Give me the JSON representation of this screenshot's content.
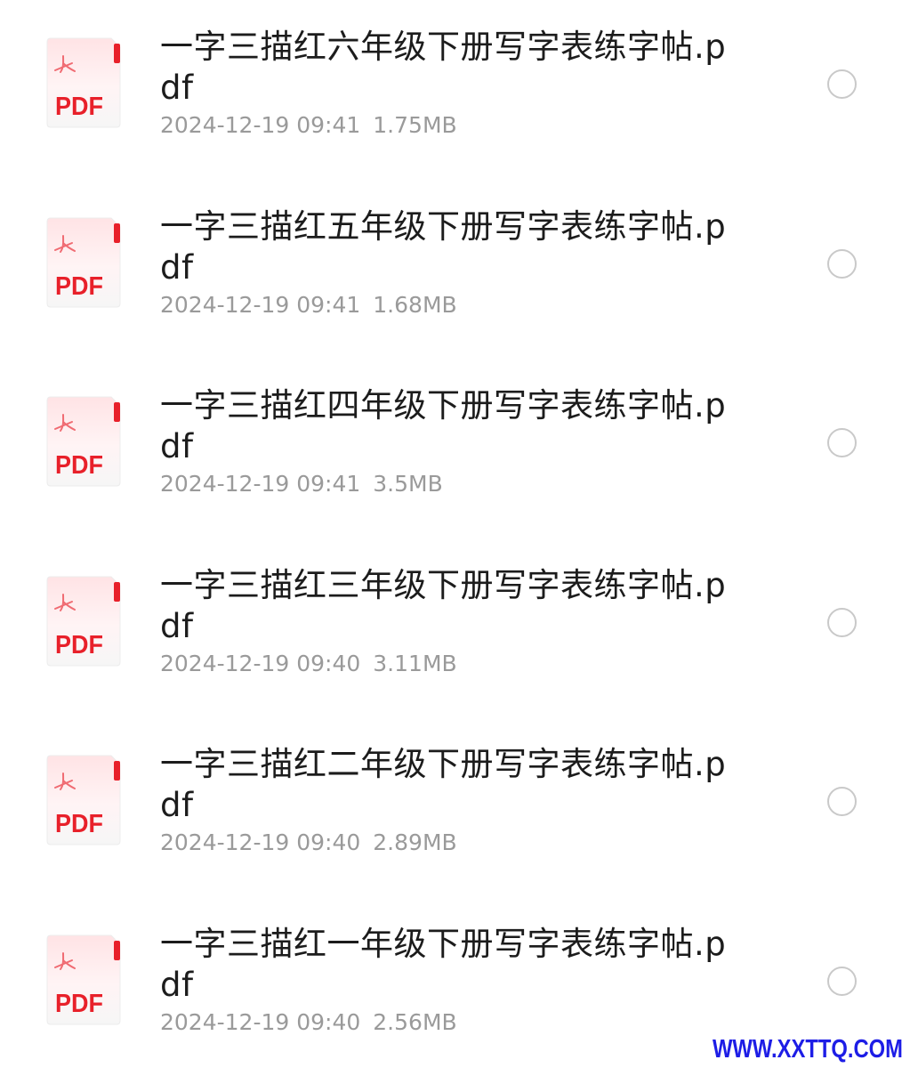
{
  "files": [
    {
      "name": "一字三描红六年级下册写字表练字帖.pdf",
      "date": "2024-12-19 09:41",
      "size": "1.75MB",
      "icon": "pdf-file-icon",
      "badge": "PDF"
    },
    {
      "name": "一字三描红五年级下册写字表练字帖.pdf",
      "date": "2024-12-19 09:41",
      "size": "1.68MB",
      "icon": "pdf-file-icon",
      "badge": "PDF"
    },
    {
      "name": "一字三描红四年级下册写字表练字帖.pdf",
      "date": "2024-12-19 09:41",
      "size": "3.5MB",
      "icon": "pdf-file-icon",
      "badge": "PDF"
    },
    {
      "name": "一字三描红三年级下册写字表练字帖.pdf",
      "date": "2024-12-19 09:40",
      "size": "3.11MB",
      "icon": "pdf-file-icon",
      "badge": "PDF"
    },
    {
      "name": "一字三描红二年级下册写字表练字帖.pdf",
      "date": "2024-12-19 09:40",
      "size": "2.89MB",
      "icon": "pdf-file-icon",
      "badge": "PDF"
    },
    {
      "name": "一字三描红一年级下册写字表练字帖.pdf",
      "date": "2024-12-19 09:40",
      "size": "2.56MB",
      "icon": "pdf-file-icon",
      "badge": "PDF"
    }
  ],
  "watermark": "WWW.XXTTQ.COM",
  "colors": {
    "pdf_red": "#e8202a",
    "text": "#1c1c1c",
    "meta": "#9a9a9a",
    "radio_border": "#c9c9c9",
    "watermark": "#1d1de6"
  }
}
